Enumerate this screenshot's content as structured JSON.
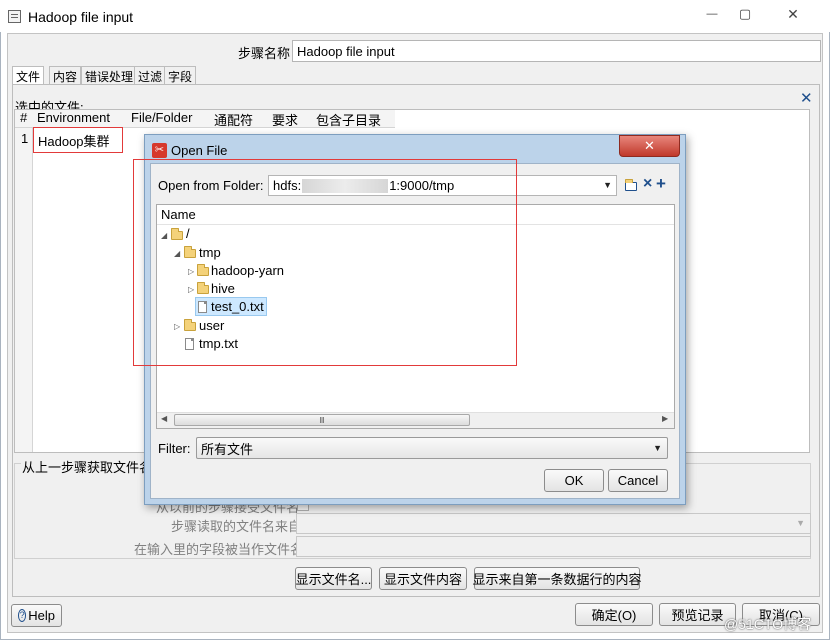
{
  "window": {
    "title": "Hadoop file input",
    "min_glyph": "—",
    "max_glyph": "▢",
    "close_glyph": "✕"
  },
  "step": {
    "label": "步骤名称",
    "value": "Hadoop file input"
  },
  "tabs": [
    "文件",
    "内容",
    "错误处理",
    "过滤",
    "字段"
  ],
  "selected_files": {
    "label": "选中的文件:",
    "close_glyph": "✕",
    "columns": [
      "#",
      "Environment",
      "File/Folder",
      "通配符",
      "要求",
      "包含子目录"
    ],
    "rows": [
      {
        "num": "1",
        "environment": "Hadoop集群"
      }
    ]
  },
  "prev_step": {
    "label": "从上一步骤获取文件名",
    "row1_label": "从以前的步骤接受文件名",
    "row2_label": "步骤读取的文件名来自",
    "row3_label": "在输入里的字段被当作文件名"
  },
  "buttons": {
    "show_filenames": "显示文件名...",
    "show_content": "显示文件内容",
    "show_first_row": "显示来自第一条数据行的内容",
    "help": "Help",
    "ok": "确定(O)",
    "preview": "预览记录",
    "cancel": "取消(C)"
  },
  "dialog": {
    "title": "Open File",
    "close_glyph": "✕",
    "folder_label": "Open from Folder:",
    "folder_prefix": "hdfs:",
    "folder_suffix": "1:9000/tmp",
    "tree_header": "Name",
    "tree": {
      "root": "/",
      "tmp": "tmp",
      "hadoop_yarn": "hadoop-yarn",
      "hive": "hive",
      "test_file": "test_0.txt",
      "user": "user",
      "tmp_txt": "tmp.txt"
    },
    "scroll_grip": "Ⅲ",
    "filter_label": "Filter:",
    "filter_value": "所有文件",
    "ok": "OK",
    "cancel": "Cancel"
  },
  "watermark": "@51CTO博客",
  "colors": {
    "highlight": "#e23a3a",
    "title_close": "#c9453a",
    "selection": "#cde8ff"
  }
}
